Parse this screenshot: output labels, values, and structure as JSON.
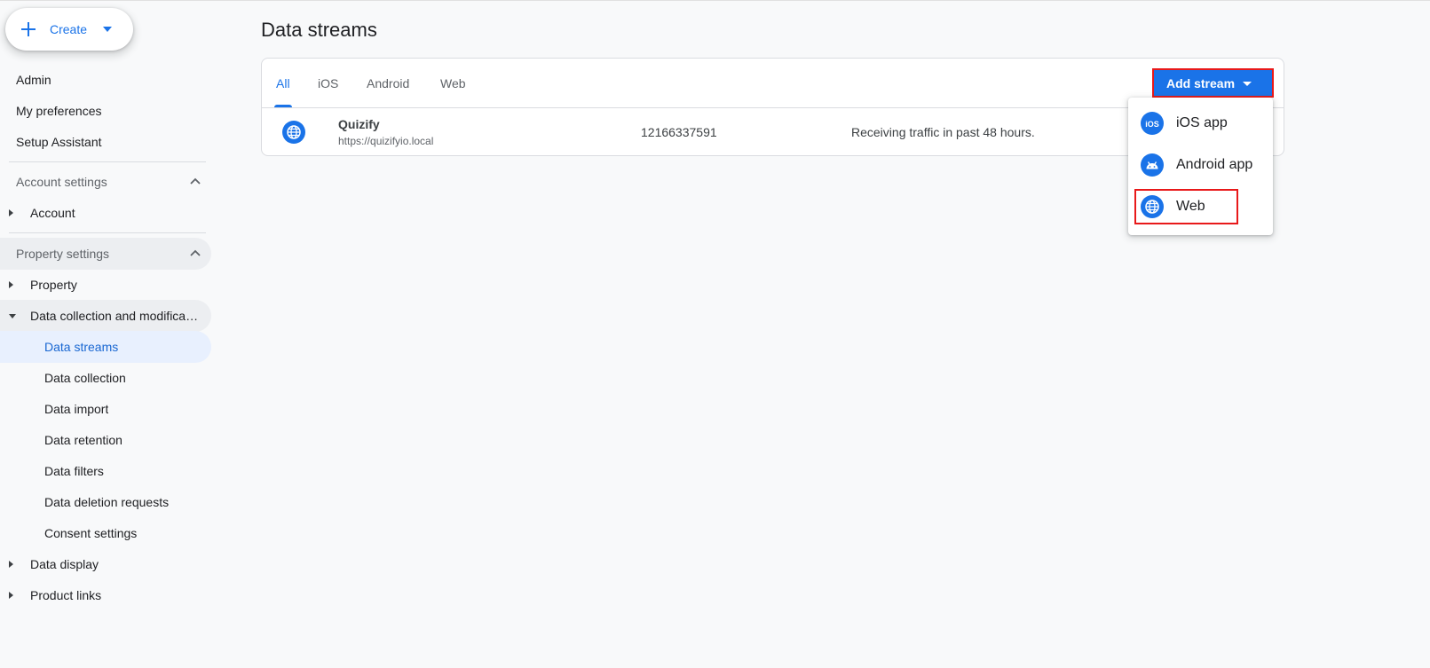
{
  "create": {
    "label": "Create"
  },
  "sidebar": {
    "top_items": [
      "Admin",
      "My preferences",
      "Setup Assistant"
    ],
    "account_settings": {
      "header": "Account settings",
      "items": [
        "Account"
      ]
    },
    "property_settings": {
      "header": "Property settings",
      "property": "Property",
      "data_collection_group": "Data collection and modifica…",
      "sub_items": [
        "Data streams",
        "Data collection",
        "Data import",
        "Data retention",
        "Data filters",
        "Data deletion requests",
        "Consent settings"
      ],
      "data_display": "Data display",
      "product_links": "Product links"
    }
  },
  "main": {
    "title": "Data streams",
    "tabs": [
      "All",
      "iOS",
      "Android",
      "Web"
    ],
    "selected_tab": "All",
    "add_stream_label": "Add stream",
    "streams": [
      {
        "name": "Quizify",
        "url": "https://quizifyio.local",
        "stream_id": "12166337591",
        "status": "Receiving traffic in past 48 hours."
      }
    ],
    "add_stream_menu": [
      "iOS app",
      "Android app",
      "Web"
    ]
  },
  "colors": {
    "accent": "#1a73e8",
    "highlight": "#e8191a"
  }
}
